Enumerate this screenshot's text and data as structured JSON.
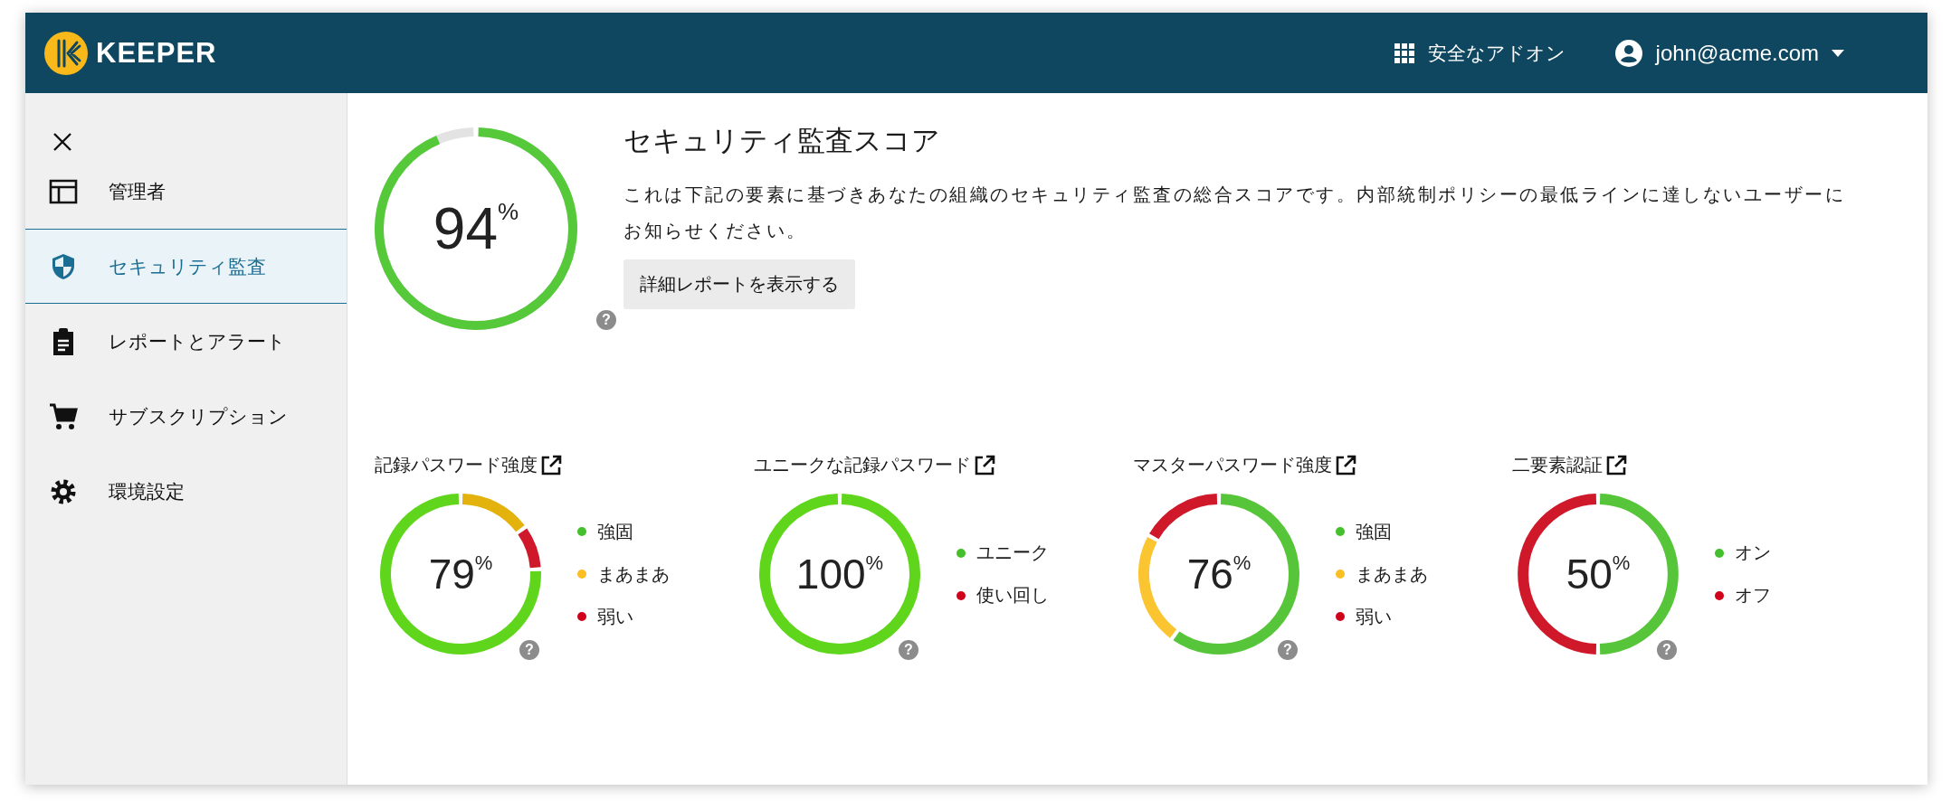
{
  "header": {
    "logo": "KEEPER",
    "addons": "安全なアドオン",
    "user": "john@acme.com"
  },
  "sidebar": {
    "items": [
      {
        "label": "管理者",
        "selected": false
      },
      {
        "label": "セキュリティ監査",
        "selected": true
      },
      {
        "label": "レポートとアラート",
        "selected": false
      },
      {
        "label": "サブスクリプション",
        "selected": false
      },
      {
        "label": "環境設定",
        "selected": false
      }
    ]
  },
  "score": {
    "title": "セキュリティ監査スコア",
    "value": "94",
    "unit": "%",
    "help": "?",
    "description": "これは下記の要素に基づきあなたの組織のセキュリティ監査の総合スコアです。内部統制ポリシーの最低ラインに達しないユーザーにお知らせください。",
    "button": "詳細レポートを表示する"
  },
  "gauges": [
    {
      "title": "記録パスワード強度",
      "value": "79",
      "unit": "%",
      "help": "?",
      "segments": [
        {
          "color": "#e3b20c"
        },
        {
          "color": "#d0182b"
        },
        {
          "color": "#5fd61b"
        }
      ],
      "legend": [
        {
          "label": "強固",
          "color": "#44c02c"
        },
        {
          "label": "まあまあ",
          "color": "#fbbf24"
        },
        {
          "label": "弱い",
          "color": "#d0021b"
        }
      ]
    },
    {
      "title": "ユニークな記録パスワード",
      "value": "100",
      "unit": "%",
      "help": "?",
      "segments": [
        {
          "color": "#5fd61b"
        }
      ],
      "legend": [
        {
          "label": "ユニーク",
          "color": "#44c02c"
        },
        {
          "label": "使い回し",
          "color": "#d0021b"
        }
      ]
    },
    {
      "title": "マスターパスワード強度",
      "value": "76",
      "unit": "%",
      "help": "?",
      "segments": [
        {
          "color": "#57c53a"
        },
        {
          "color": "#fbc531"
        },
        {
          "color": "#d0182b"
        }
      ],
      "legend": [
        {
          "label": "強固",
          "color": "#44c02c"
        },
        {
          "label": "まあまあ",
          "color": "#fbbf24"
        },
        {
          "label": "弱い",
          "color": "#d0021b"
        }
      ]
    },
    {
      "title": "二要素認証",
      "value": "50",
      "unit": "%",
      "help": "?",
      "segments": [
        {
          "color": "#57c53a"
        },
        {
          "color": "#d0182b"
        }
      ],
      "legend": [
        {
          "label": "オン",
          "color": "#44c02c"
        },
        {
          "label": "オフ",
          "color": "#d0021b"
        }
      ]
    }
  ]
}
